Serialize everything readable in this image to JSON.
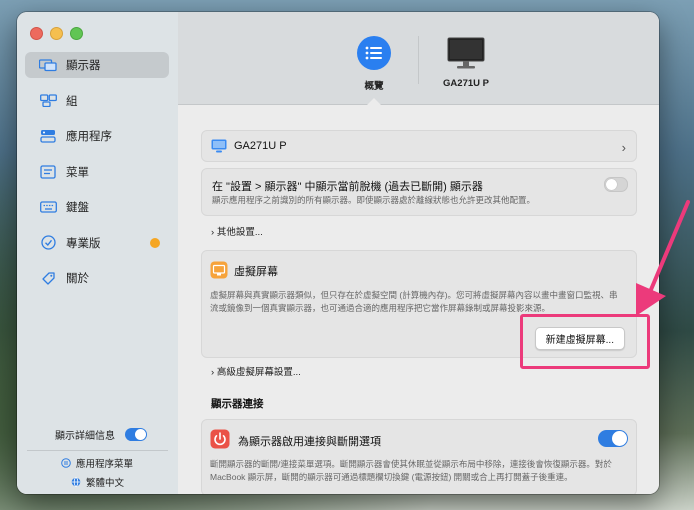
{
  "sidebar": {
    "items": [
      {
        "label": "顯示器",
        "icon": "displays-icon",
        "active": true
      },
      {
        "label": "組",
        "icon": "group-icon",
        "active": false
      },
      {
        "label": "應用程序",
        "icon": "apps-icon",
        "active": false
      },
      {
        "label": "菜單",
        "icon": "menu-icon",
        "active": false
      },
      {
        "label": "鍵盤",
        "icon": "keyboard-icon",
        "active": false
      },
      {
        "label": "專業版",
        "icon": "pro-badge-icon",
        "active": false
      },
      {
        "label": "關於",
        "icon": "tag-icon",
        "active": false
      }
    ],
    "detail_info_label": "顯示詳細信息",
    "detail_info_on": true,
    "app_menu_label": "應用程序菜單",
    "language_label": "繁體中文"
  },
  "tabs": [
    {
      "label": "概覽",
      "icon": "list-icon",
      "selected": true
    },
    {
      "label": "GA271U P",
      "icon": "monitor-icon",
      "selected": false
    }
  ],
  "main": {
    "display_row": {
      "label": "GA271U P"
    },
    "show_disconnected": {
      "title": "在 \"設置 > 顯示器\" 中顯示當前脫機 (過去已斷開) 顯示器",
      "desc": "顯示應用程序之前識別的所有顯示器。即使顯示器處於離線狀態也允許更改其他配置。",
      "enabled": false
    },
    "other_settings_label": "其他設置...",
    "virtual_screen": {
      "title": "虛擬屏幕",
      "desc": "虛擬屏幕與真實顯示器類似，但只存在於虛擬空間 (計算機內存)。您可將虛擬屏幕內容以畫中畫窗口監視、串流或鏡像到一個真實顯示器，也可通過合適的應用程序把它當作屏幕錄制或屏幕投影來源。",
      "button_label": "新建虛擬屏幕..."
    },
    "advanced_virtual_label": "高級虛擬屏幕設置...",
    "connection_heading": "顯示器連接",
    "connection_row": {
      "title": "為顯示器啟用連接與斷開選項",
      "desc": "斷開顯示器的斷開/連接菜單選項。斷開顯示器會使其休眠並從顯示布局中移除，連接後會恢復顯示器。對於 MacBook 顯示屏，斷開的顯示器可通過標題欄切換鍵 (電源按鈕) 開關或合上再打開蓋子後重連。",
      "enabled": true
    }
  },
  "colors": {
    "accent": "#2a7ff0",
    "annotation": "#ec3a7b",
    "pro_dot": "#f5a623"
  }
}
